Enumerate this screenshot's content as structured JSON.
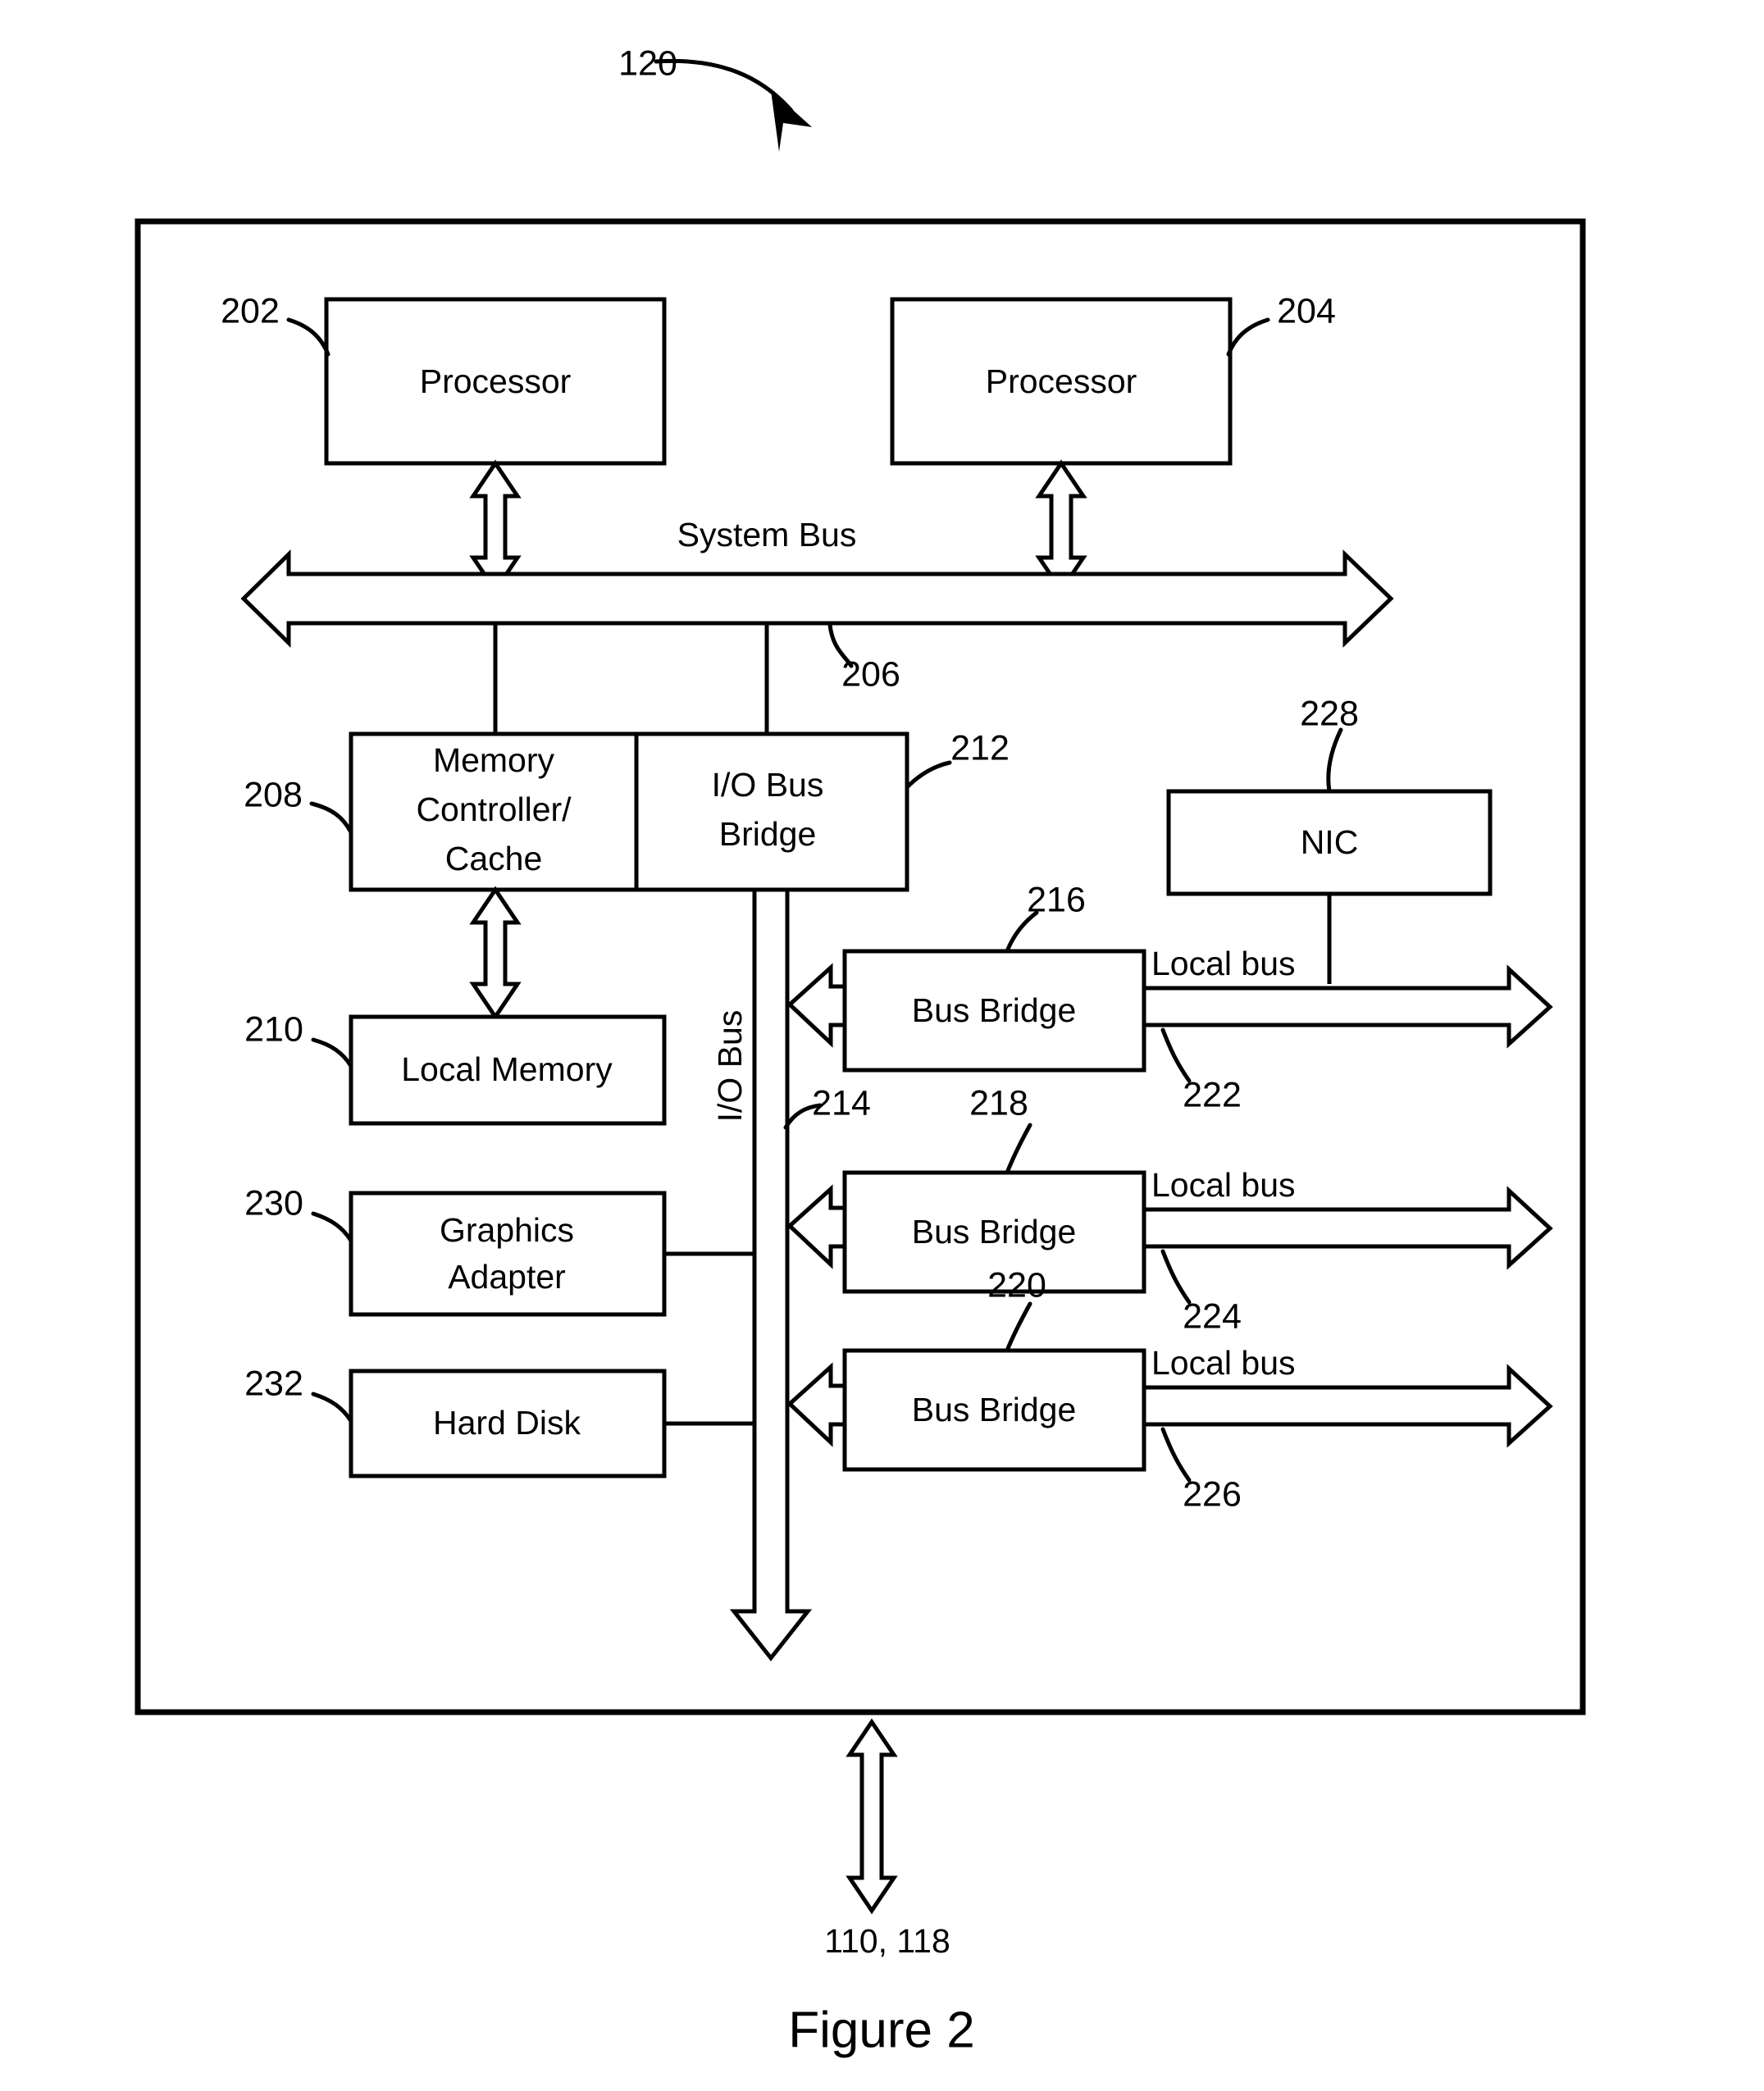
{
  "figure": {
    "caption": "Figure 2",
    "system_ref": "120",
    "external_ref": "110, 118"
  },
  "blocks": {
    "processor_1": {
      "label": "Processor",
      "ref": "202"
    },
    "processor_2": {
      "label": "Processor",
      "ref": "204"
    },
    "memory_controller": {
      "label_line1": "Memory",
      "label_line2": "Controller/",
      "label_line3": "Cache",
      "ref": "208"
    },
    "io_bus_bridge": {
      "label_line1": "I/O Bus",
      "label_line2": "Bridge",
      "ref": "212"
    },
    "local_memory": {
      "label": "Local Memory",
      "ref": "210"
    },
    "graphics_adapter": {
      "label_line1": "Graphics",
      "label_line2": "Adapter",
      "ref": "230"
    },
    "hard_disk": {
      "label": "Hard Disk",
      "ref": "232"
    },
    "nic": {
      "label": "NIC",
      "ref": "228"
    },
    "bus_bridge_1": {
      "label": "Bus Bridge",
      "ref": "216"
    },
    "bus_bridge_2": {
      "label": "Bus Bridge",
      "ref": "218"
    },
    "bus_bridge_3": {
      "label": "Bus Bridge",
      "ref": "220"
    }
  },
  "buses": {
    "system_bus": {
      "label": "System Bus",
      "ref": "206"
    },
    "io_bus": {
      "label": "I/O Bus",
      "ref": "214"
    },
    "local_bus_1": {
      "label": "Local bus",
      "ref": "222"
    },
    "local_bus_2": {
      "label": "Local bus",
      "ref": "224"
    },
    "local_bus_3": {
      "label": "Local bus",
      "ref": "226"
    }
  },
  "colors": {
    "ink": "#000000",
    "paper": "#ffffff"
  }
}
